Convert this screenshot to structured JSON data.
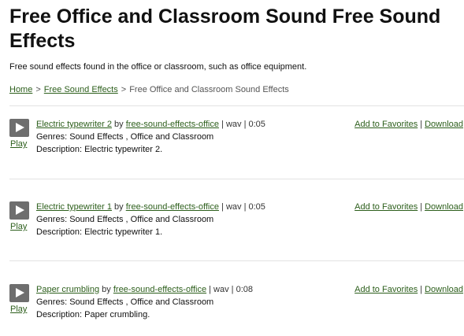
{
  "page": {
    "title": "Free Office and Classroom Sound Free Sound Effects",
    "intro": "Free sound effects found in the office or classroom, such as office equipment."
  },
  "breadcrumb": {
    "home": "Home",
    "category": "Free Sound Effects",
    "current": "Free Office and Classroom Sound Effects",
    "separator": ">"
  },
  "labels": {
    "by": "by",
    "genres_prefix": "Genres:",
    "description_prefix": "Description:",
    "play": "Play",
    "add_favorites": "Add to Favorites",
    "download": "Download",
    "pipe": "|"
  },
  "sounds": [
    {
      "name": "Electric typewriter 2",
      "author": "free-sound-effects-office",
      "format": "wav",
      "duration": "0:05",
      "genres": "Sound Effects , Office and Classroom",
      "description": "Electric typewriter 2."
    },
    {
      "name": "Electric typewriter 1",
      "author": "free-sound-effects-office",
      "format": "wav",
      "duration": "0:05",
      "genres": "Sound Effects , Office and Classroom",
      "description": "Electric typewriter 1."
    },
    {
      "name": "Paper crumbling",
      "author": "free-sound-effects-office",
      "format": "wav",
      "duration": "0:08",
      "genres": "Sound Effects , Office and Classroom",
      "description": "Paper crumbling."
    }
  ]
}
